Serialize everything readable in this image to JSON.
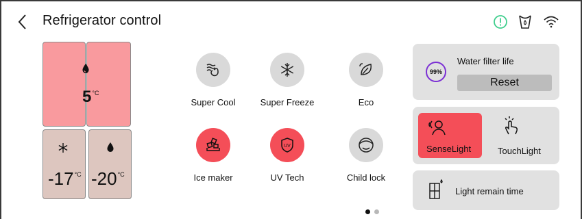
{
  "header": {
    "title": "Refrigerator control",
    "icons": [
      "back-chevron-icon",
      "alert-icon",
      "filter-cup-icon",
      "wifi-icon"
    ]
  },
  "fridge": {
    "fridge_temp": "5",
    "fridge_unit": "°C",
    "freezer_left_temp": "-17",
    "freezer_right_temp": "-20",
    "freezer_unit": "°C",
    "fridge_color": "#f99a9e",
    "freezer_color": "#ddc6bf"
  },
  "features": [
    {
      "label": "Super Cool",
      "icon": "super-cool-icon",
      "active": false
    },
    {
      "label": "Super Freeze",
      "icon": "snowflake-icon",
      "active": false
    },
    {
      "label": "Eco",
      "icon": "eco-leaf-icon",
      "active": false
    },
    {
      "label": "Ice maker",
      "icon": "ice-cubes-icon",
      "active": true
    },
    {
      "label": "UV Tech",
      "icon": "uv-shield-icon",
      "active": true
    },
    {
      "label": "Child lock",
      "icon": "child-face-icon",
      "active": false
    }
  ],
  "water_filter": {
    "label": "Water filter life",
    "percent": "99%",
    "reset_label": "Reset"
  },
  "lighting": {
    "sense_label": "SenseLight",
    "touch_label": "TouchLight",
    "active": "SenseLight",
    "remain_label": "Light remain time"
  },
  "pagination": {
    "current": 1,
    "total": 2
  },
  "colors": {
    "accent": "#f44e58",
    "panel": "#e1e1e1",
    "off_circle": "#d9d9d9",
    "alert": "#3fce8d",
    "filter_ring": "#7b2fd4"
  }
}
